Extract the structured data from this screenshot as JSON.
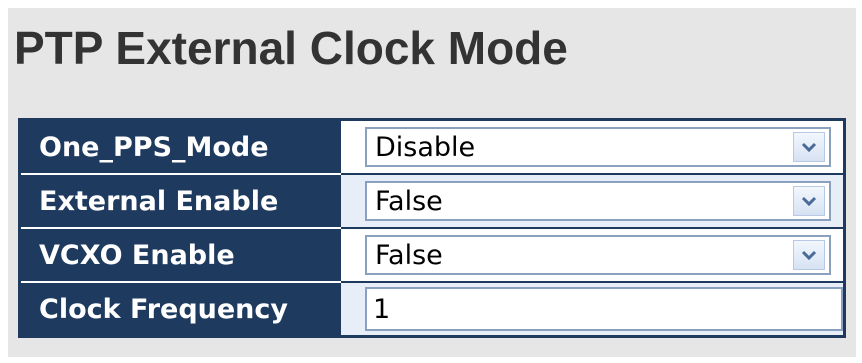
{
  "page": {
    "title": "PTP External Clock Mode"
  },
  "form": {
    "rows": [
      {
        "label": "One_PPS_Mode",
        "type": "select",
        "value": "Disable",
        "icon": "chevron-down-icon"
      },
      {
        "label": "External Enable",
        "type": "select",
        "value": "False",
        "icon": "chevron-down-icon"
      },
      {
        "label": "VCXO Enable",
        "type": "select",
        "value": "False",
        "icon": "chevron-down-icon"
      },
      {
        "label": "Clock Frequency",
        "type": "text",
        "value": "1"
      }
    ]
  },
  "colors": {
    "header_bg": "#1f3a5f",
    "panel_bg": "#e6e6e6",
    "alt_row_bg": "#e8eef8",
    "title_text": "#333333"
  }
}
